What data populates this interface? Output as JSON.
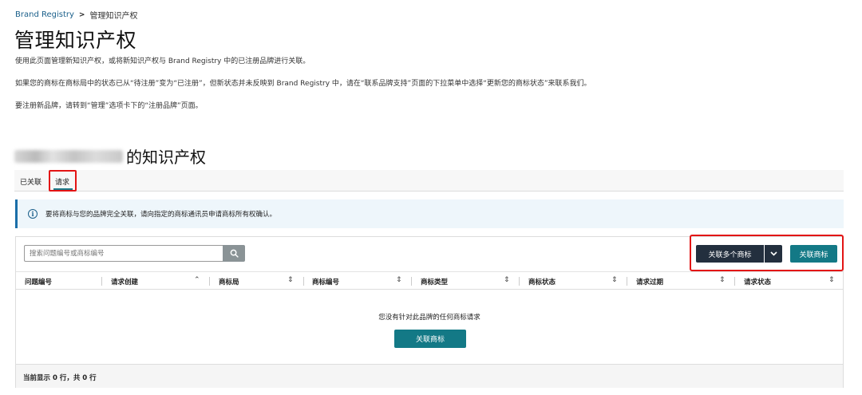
{
  "breadcrumb": {
    "root": "Brand Registry",
    "separator": ">",
    "current": "管理知识产权"
  },
  "page_title": "管理知识产权",
  "paragraphs": {
    "p1": "使用此页面管理新知识产权，或将新知识产权与 Brand Registry 中的已注册品牌进行关联。",
    "p2": "如果您的商标在商标局中的状态已从“待注册”变为“已注册”，但新状态并未反映到 Brand Registry 中，请在“联系品牌支持”页面的下拉菜单中选择“更新您的商标状态”来联系我们。",
    "p3": "要注册新品牌，请转到“管理”选项卡下的“注册品牌”页面。"
  },
  "brand_section": {
    "heading_suffix": "的知识产权"
  },
  "tabs": [
    {
      "label": "已关联"
    },
    {
      "label": "请求"
    }
  ],
  "info": {
    "icon": "info-icon",
    "text": "要将商标与您的品牌完全关联，请向指定的商标通讯员申请商标所有权确认。"
  },
  "search": {
    "placeholder": "搜索问题编号或商标编号",
    "icon": "search-icon"
  },
  "buttons": {
    "link_multiple": "关联多个商标",
    "link_trademark": "关联商标",
    "link_trademark_center": "关联商标"
  },
  "table": {
    "columns": [
      "问题编号",
      "请求创建",
      "商标局",
      "商标编号",
      "商标类型",
      "商标状态",
      "请求过期",
      "请求状态"
    ],
    "empty_message": "您没有针对此品牌的任何商标请求",
    "footer": "当前显示 0 行，共 0 行"
  },
  "colors": {
    "primary_teal": "#137986",
    "dark_button": "#232f3e",
    "link_blue": "#1a5f8a",
    "highlight_red": "#e31414"
  }
}
